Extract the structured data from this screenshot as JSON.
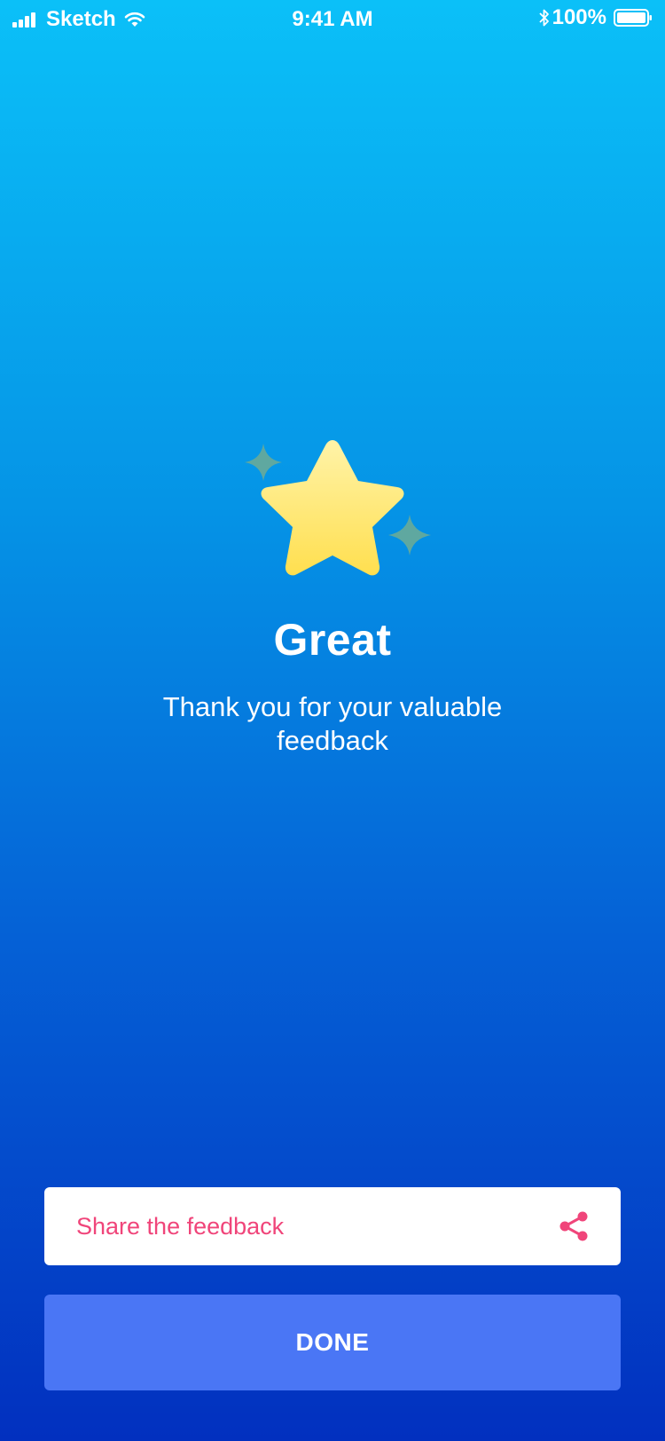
{
  "status_bar": {
    "carrier": "Sketch",
    "time": "9:41 AM",
    "battery": "100%"
  },
  "main": {
    "title": "Great",
    "subtitle": "Thank you for your valuable feedback",
    "icons": [
      "star-icon",
      "sparkle-icon"
    ]
  },
  "actions": {
    "share_label": "Share the feedback",
    "done_label": "DONE"
  },
  "colors": {
    "background_top": "#0BC0F8",
    "background_bottom": "#0230BF",
    "accent_pink": "#F0457A",
    "done_button": "#4A76F5",
    "star": "#FFE36A",
    "sparkle": "#5FA8A0"
  }
}
